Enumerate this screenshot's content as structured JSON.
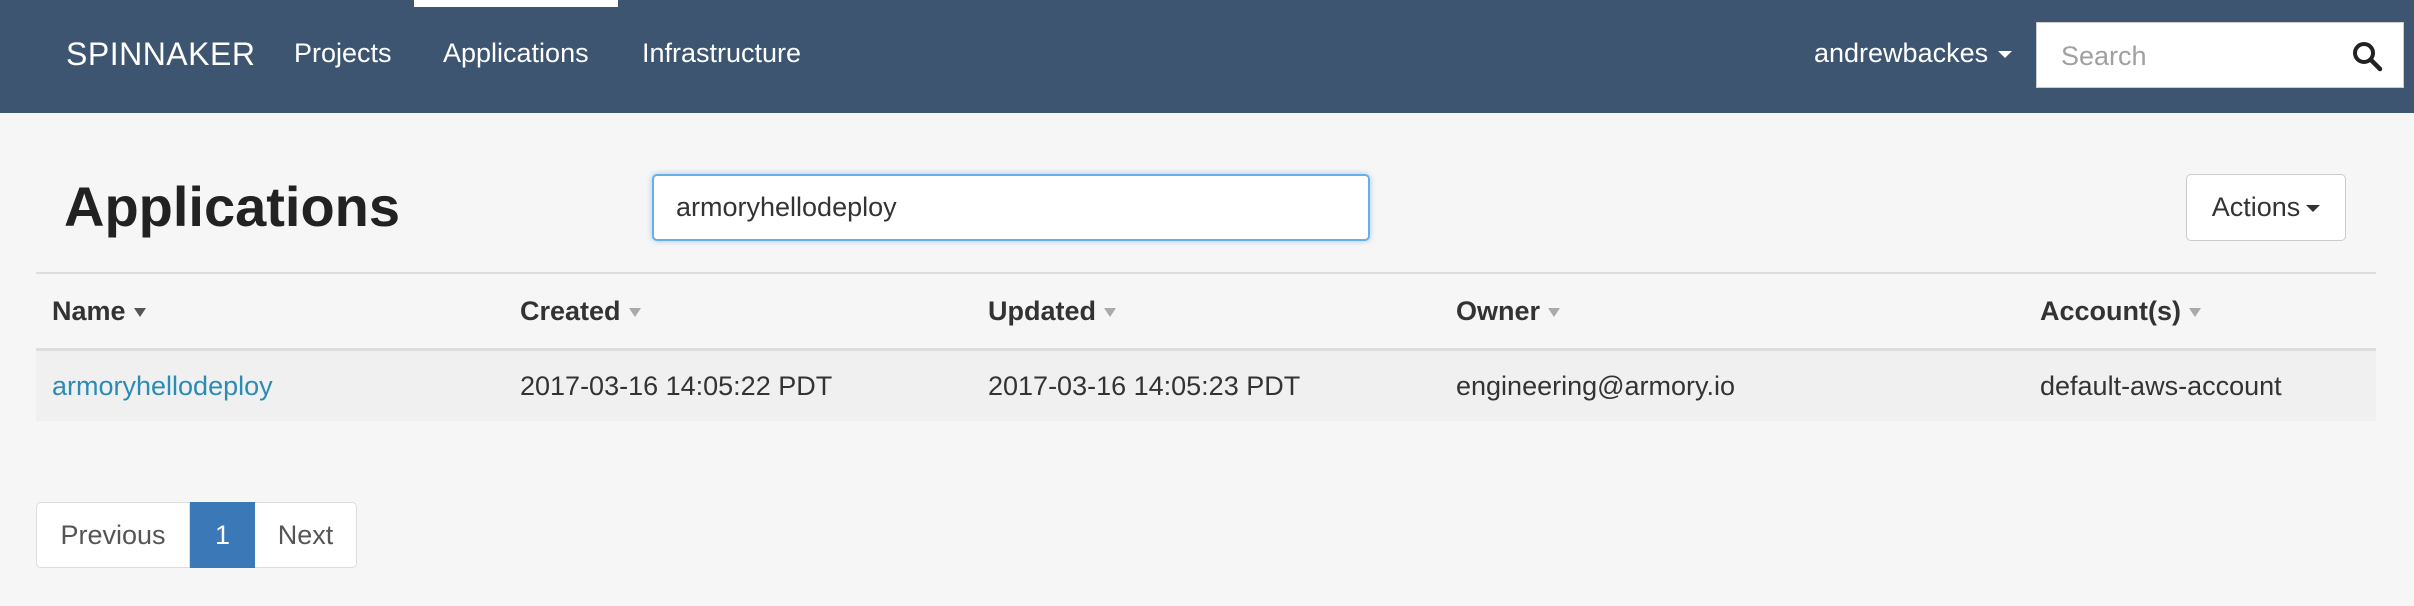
{
  "navbar": {
    "brand": "SPINNAKER",
    "items": [
      {
        "label": "Projects"
      },
      {
        "label": "Applications"
      },
      {
        "label": "Infrastructure"
      }
    ],
    "user": "andrewbackes",
    "search_placeholder": "Search"
  },
  "page": {
    "title": "Applications",
    "filter_value": "armoryhellodeploy",
    "actions_label": "Actions"
  },
  "table": {
    "columns": [
      {
        "label": "Name"
      },
      {
        "label": "Created"
      },
      {
        "label": "Updated"
      },
      {
        "label": "Owner"
      },
      {
        "label": "Account(s)"
      }
    ],
    "rows": [
      {
        "name": "armoryhellodeploy",
        "created": "2017-03-16 14:05:22 PDT",
        "updated": "2017-03-16 14:05:23 PDT",
        "owner": "engineering@armory.io",
        "accounts": "default-aws-account"
      }
    ]
  },
  "pagination": {
    "previous": "Previous",
    "current": "1",
    "next": "Next"
  },
  "colors": {
    "navbar": "#3d5570",
    "link": "#2a8bb5",
    "active_page": "#3a78b8"
  }
}
